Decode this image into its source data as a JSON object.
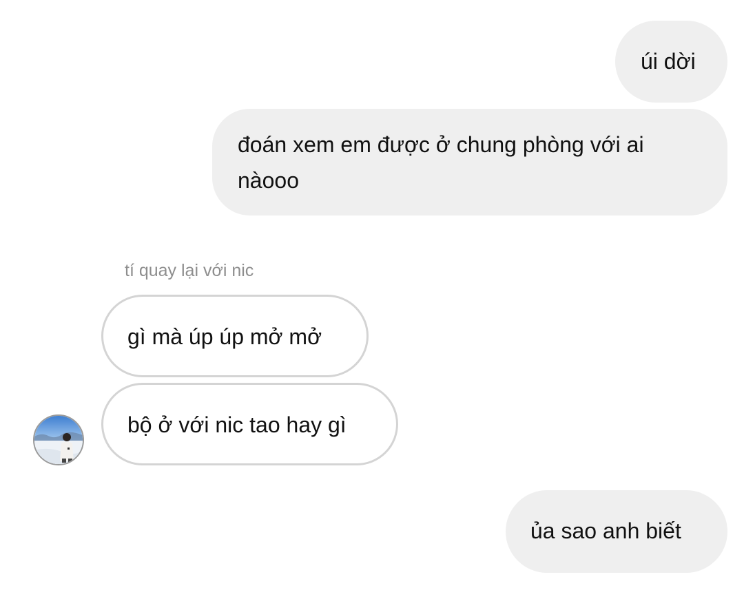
{
  "messages": [
    {
      "direction": "sent",
      "text": "úi dời"
    },
    {
      "direction": "sent",
      "text": "đoán xem em được ở chung phòng với ai nàooo"
    },
    {
      "direction": "received",
      "text": "gì mà úp úp mở mở"
    },
    {
      "direction": "received",
      "text": "bộ ở với nic tao hay gì"
    },
    {
      "direction": "sent",
      "text": "ủa sao anh biết"
    }
  ],
  "reply_label": "tí quay lại với nic",
  "avatar": {
    "icon": "profile-photo-snow-scene"
  },
  "colors": {
    "sent_bubble": "#efefef",
    "received_border": "#d4d4d4",
    "meta_text": "#8e8e8e",
    "text": "#111111"
  }
}
